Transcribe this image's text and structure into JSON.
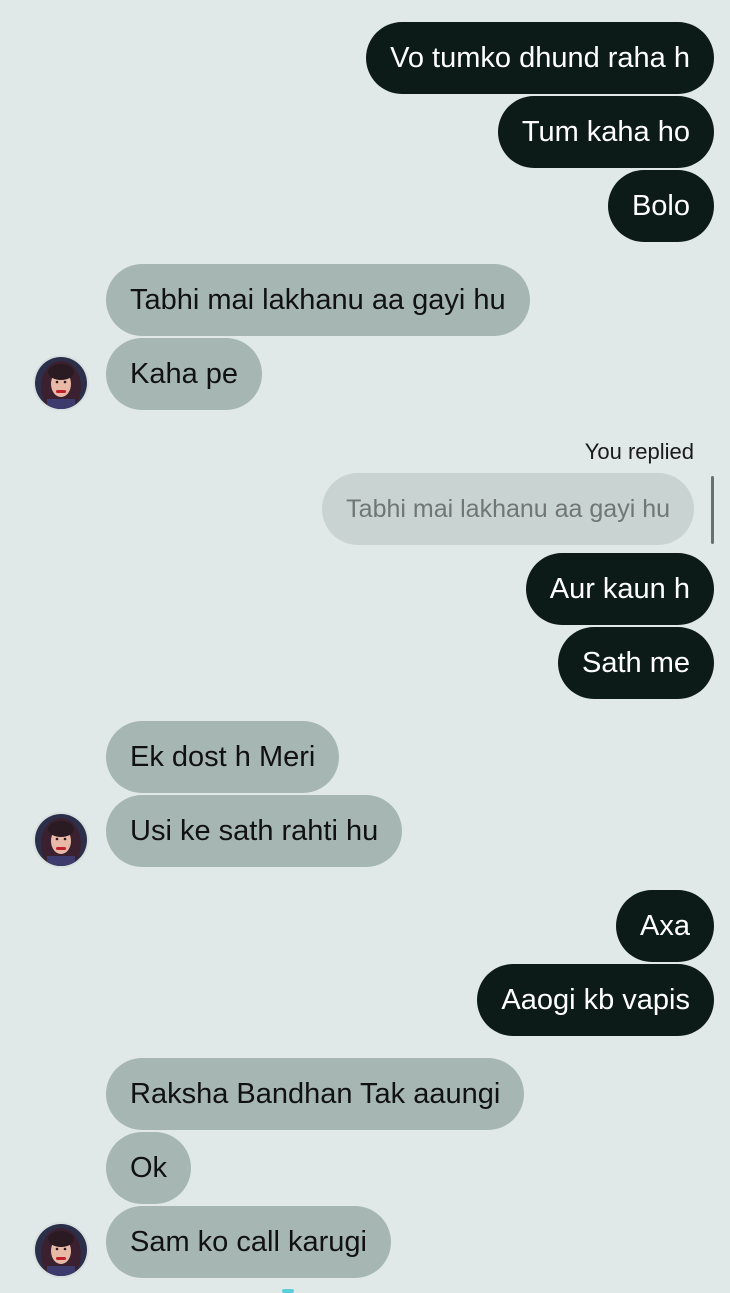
{
  "conversation": {
    "messages": [
      {
        "from": "me",
        "text": "Vo tumko dhund raha h"
      },
      {
        "from": "me",
        "text": "Tum kaha ho"
      },
      {
        "from": "me",
        "text": "Bolo"
      },
      {
        "from": "them",
        "text": "Tabhi mai lakhanu aa gayi hu"
      },
      {
        "from": "them",
        "text": "Kaha pe"
      },
      {
        "from": "me",
        "text": "Aur kaun h"
      },
      {
        "from": "me",
        "text": "Sath me"
      },
      {
        "from": "them",
        "text": "Ek dost h Meri"
      },
      {
        "from": "them",
        "text": "Usi ke sath rahti hu"
      },
      {
        "from": "me",
        "text": "Axa"
      },
      {
        "from": "me",
        "text": "Aaogi kb vapis"
      },
      {
        "from": "them",
        "text": "Raksha Bandhan Tak aaungi"
      },
      {
        "from": "them",
        "text": "Ok"
      },
      {
        "from": "them",
        "text": "Sam ko call karugi"
      }
    ],
    "reply": {
      "label": "You replied",
      "quoted_text": "Tabhi mai lakhanu aa gayi hu"
    },
    "avatar_icon": "contact-profile-avatar"
  },
  "colors": {
    "background": "#e1e9e8",
    "sent_bubble": "#0d1b18",
    "received_bubble": "#a6b7b3",
    "quoted_bubble": "#c9d3d1"
  }
}
